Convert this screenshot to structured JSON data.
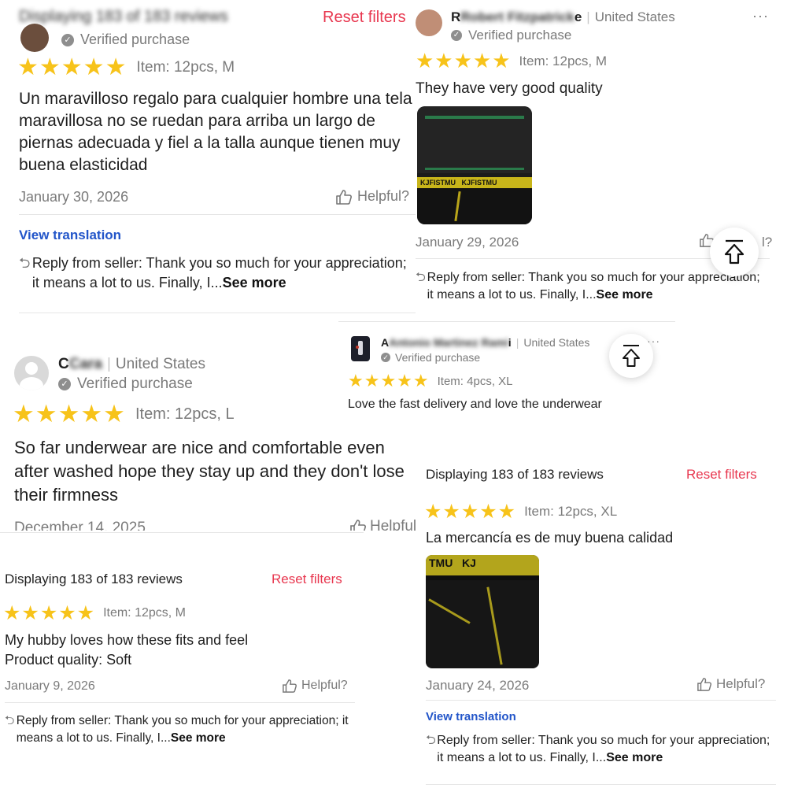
{
  "panel_a": {
    "header_blurred": "Displaying 183 of 183 reviews",
    "reset": "Reset filters",
    "verified": "Verified purchase",
    "stars": "★★★★★",
    "item": "Item: 12pcs, M",
    "body": "Un maravilloso regalo para cualquier hombre una tela maravillosa no se ruedan para arriba un largo de piernas adecuada y fiel a la talla aunque tienen muy buena elasticidad",
    "date": "January 30, 2026",
    "helpful": "Helpful?",
    "view_translation": "View translation",
    "reply": "Reply from seller: Thank you so much for your appreciation; it means a lot to us. Finally, I...",
    "see_more": "See more"
  },
  "panel_b": {
    "name_first": "R",
    "name_blurred": "Robert Fitzpatrick",
    "name_last": "e",
    "country": "United States",
    "verified": "Verified purchase",
    "stars": "★★★★★",
    "item": "Item: 12pcs, M",
    "body": "They have very good quality",
    "photo_text": "KJFISTMU   KJFISTMU",
    "date": "January 29, 2026",
    "helpful_partial": "l?",
    "reply": "Reply from seller: Thank you so much for your appreciation; it means a lot to us. Finally, I...",
    "see_more": "See more",
    "more": "···"
  },
  "panel_c": {
    "name_first": "C",
    "name_blurred": "Cara",
    "country": "United States",
    "verified": "Verified purchase",
    "stars": "★★★★★",
    "item": "Item: 12pcs, L",
    "body": "So far underwear are nice and comfortable even after washed hope they stay up and they don't lose their firmness",
    "date_cut": "December 14, 2025",
    "helpful_cut": "Helpful"
  },
  "panel_d": {
    "name_first": "A",
    "name_blurred": "Antonio Martinez Rami",
    "name_last": "i",
    "country": "United States",
    "verified": "Verified purchase",
    "stars": "★★★★★",
    "item": "Item: 4pcs, XL",
    "body": "Love the fast delivery and love the underwear",
    "more": "···"
  },
  "panel_e": {
    "header": "Displaying 183 of 183 reviews",
    "reset": "Reset filters",
    "stars": "★★★★★",
    "item": "Item: 12pcs, M",
    "body_line1": "My hubby loves how these fits and feel",
    "body_line2": "Product quality: Soft",
    "date": "January 9, 2026",
    "helpful": "Helpful?",
    "reply": "Reply from seller: Thank you so much for your appreciation; it means a lot to us. Finally, I...",
    "see_more": "See more"
  },
  "panel_f": {
    "header": "Displaying 183 of 183 reviews",
    "reset": "Reset filters",
    "stars": "★★★★★",
    "item": "Item: 12pcs, XL",
    "body": "La mercancía es de muy buena calidad",
    "photo_text": "TMU   KJ",
    "date": "January 24, 2026",
    "helpful": "Helpful?",
    "view_translation": "View translation",
    "reply": "Reply from seller: Thank you so much for your appreciation; it means a lot to us. Finally, I...",
    "see_more": "See more"
  },
  "icons": {
    "scroll_top": "arrow-up-to-top-icon",
    "thumbs_up": "thumbs-up-icon",
    "reply": "reply-arrow-icon",
    "verified": "check-badge-icon"
  },
  "colors": {
    "star": "#f7c31a",
    "reset": "#e8374f",
    "link": "#2255c9",
    "muted": "#7a7a7a"
  }
}
